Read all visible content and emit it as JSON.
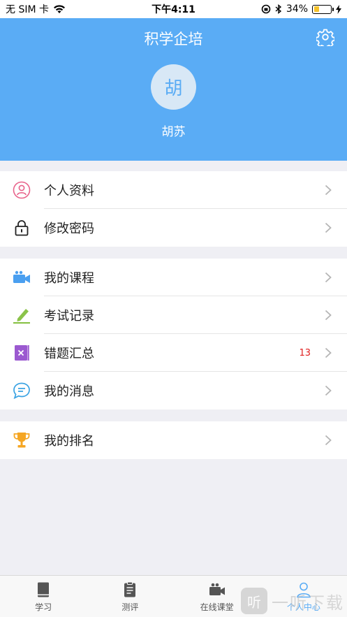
{
  "status_bar": {
    "carrier": "无 SIM 卡",
    "time": "下午4:11",
    "battery": "34%",
    "battery_level": 0.34
  },
  "header": {
    "title": "积学企培",
    "avatar_text": "胡",
    "username": "胡苏"
  },
  "group1": [
    {
      "label": "个人资料",
      "icon": "person-icon"
    },
    {
      "label": "修改密码",
      "icon": "lock-icon"
    }
  ],
  "group2": [
    {
      "label": "我的课程",
      "icon": "video-camera-icon"
    },
    {
      "label": "考试记录",
      "icon": "pen-icon"
    },
    {
      "label": "错题汇总",
      "icon": "wrong-book-icon",
      "badge": "13"
    },
    {
      "label": "我的消息",
      "icon": "message-icon"
    }
  ],
  "group3": [
    {
      "label": "我的排名",
      "icon": "trophy-icon"
    }
  ],
  "tabs": [
    {
      "label": "学习",
      "icon": "book-icon"
    },
    {
      "label": "测评",
      "icon": "clipboard-icon"
    },
    {
      "label": "在线课堂",
      "icon": "video-camera-icon"
    },
    {
      "label": "个人中心",
      "icon": "person-icon",
      "active": true
    }
  ],
  "watermark": {
    "box": "听",
    "text": "一听下载"
  },
  "colors": {
    "accent": "#5aacf5",
    "badge": "#e02020"
  }
}
